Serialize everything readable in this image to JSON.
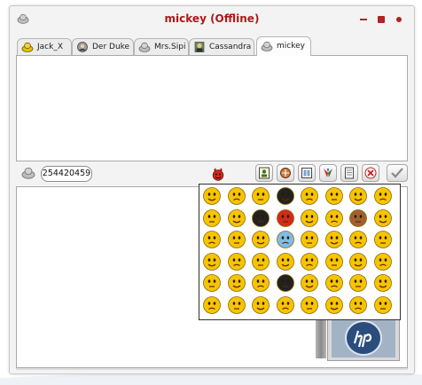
{
  "window": {
    "title": "mickey (Offline)"
  },
  "tabs": [
    {
      "label": "Jack_X",
      "icon": "yellow-contact-icon",
      "active": false
    },
    {
      "label": "Der Duke",
      "icon": "avatar-photo-icon",
      "active": false
    },
    {
      "label": "Mrs.Sipi",
      "icon": "grey-contact-icon",
      "active": false
    },
    {
      "label": "Cassandra",
      "icon": "person-avatar-icon",
      "active": false
    },
    {
      "label": "mickey",
      "icon": "grey-contact-icon",
      "active": true
    }
  ],
  "toolbar": {
    "phone_number": "254420459",
    "buttons": [
      "status-icon",
      "devil-emoticon",
      "contact-card-icon",
      "send-file-icon",
      "media-icon",
      "colors-icon",
      "notes-icon",
      "close-icon",
      "send-check-icon"
    ]
  },
  "emoticons": {
    "rows": 6,
    "columns": 8,
    "items": [
      "smile",
      "angry",
      "blush",
      "alien",
      "happy",
      "devil",
      "winking",
      "sad",
      "surprised",
      "bored",
      "ninja",
      "red-devil",
      "frown",
      "cheeky",
      "tanned",
      "crying",
      "laughing",
      "shocked",
      "stripes",
      "ice-cube",
      "sly",
      "grin",
      "wink",
      "tongue",
      "sick",
      "confused",
      "kissing",
      "puzzled",
      "nerd",
      "dizzy",
      "clown",
      "scared",
      "cool",
      "sleepy",
      "teeth",
      "bomb",
      "crazy",
      "blank",
      "whistle",
      "glad",
      "content",
      "bashful",
      "love",
      "thinking",
      "shy",
      "cheering",
      "flower",
      "dots"
    ]
  },
  "colors": {
    "title_red": "#b01818",
    "emoji_yellow": "#f7c400",
    "panel_border": "#303030",
    "avatar_logo": "#2b4d7e"
  }
}
